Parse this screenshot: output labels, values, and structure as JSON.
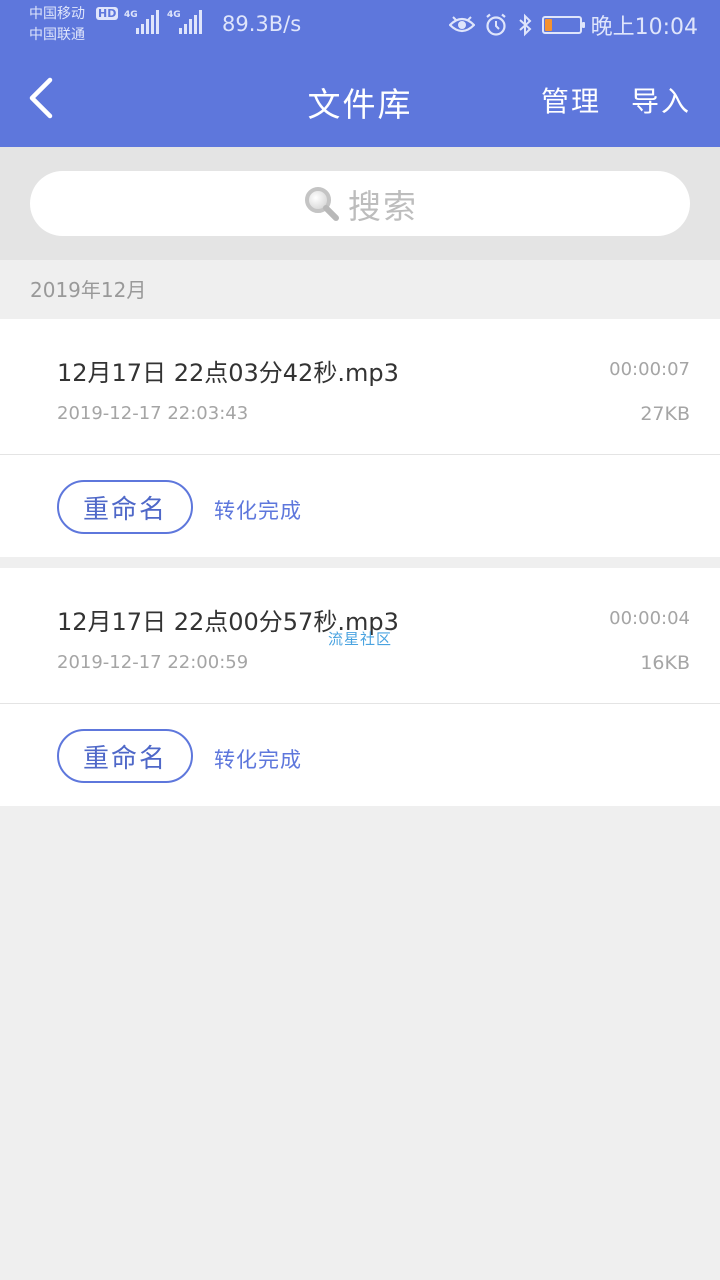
{
  "status_bar": {
    "carrier_1": "中国移动",
    "carrier_2": "中国联通",
    "hd_badge": "HD",
    "signal_1_label": "4G",
    "signal_2_label": "4G",
    "net_speed": "89.3B/s",
    "icons": [
      "eye-icon",
      "alarm-icon",
      "bluetooth-icon",
      "battery-icon"
    ],
    "battery_level": 0.2,
    "time": "晚上10:04"
  },
  "nav": {
    "title": "文件库",
    "manage": "管理",
    "import": "导入",
    "back_icon": "chevron-left-icon"
  },
  "search": {
    "placeholder": "搜索",
    "icon": "search-icon"
  },
  "files_section": {
    "month": "2019年12月",
    "files": [
      {
        "name": "12月17日 22点03分42秒.mp3",
        "date": "2019-12-17 22:03:43",
        "duration": "00:00:07",
        "size": "27KB",
        "rename_label": "重命名",
        "status": "转化完成"
      },
      {
        "name": "12月17日 22点00分57秒.mp3",
        "date": "2019-12-17 22:00:59",
        "duration": "00:00:04",
        "size": "16KB",
        "rename_label": "重命名",
        "status": "转化完成"
      }
    ]
  },
  "watermark": "流星社区",
  "colors": {
    "header": "#5e77dc",
    "accent": "#5e77dc",
    "background": "#efefef",
    "battery": "#f5922f"
  }
}
